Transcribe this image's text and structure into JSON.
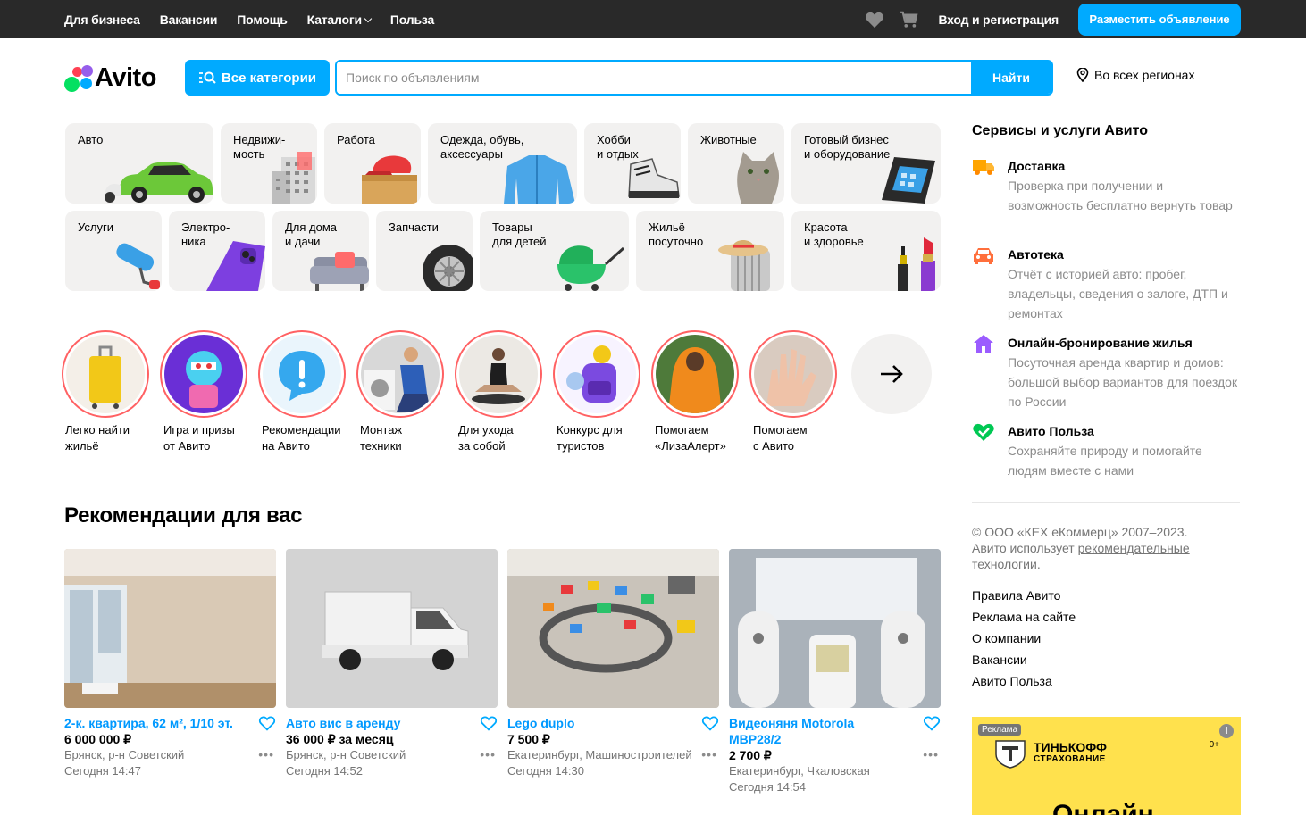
{
  "topbar": {
    "links": [
      "Для бизнеса",
      "Вакансии",
      "Помощь",
      "Каталоги",
      "Польза"
    ],
    "login": "Вход и регистрация",
    "post_button": "Разместить объявление"
  },
  "header": {
    "logo": "Avito",
    "categories_button": "Все категории",
    "search_placeholder": "Поиск по объявлениям",
    "search_button": "Найти",
    "region": "Во всех регионах"
  },
  "categories": [
    {
      "label": "Авто"
    },
    {
      "label": "Недвижи-\nмость"
    },
    {
      "label": "Работа"
    },
    {
      "label": "Одежда, обувь,\nаксессуары"
    },
    {
      "label": "Хобби\nи отдых"
    },
    {
      "label": "Животные"
    },
    {
      "label": "Готовый бизнес\nи оборудование"
    },
    {
      "label": "Услуги"
    },
    {
      "label": "Электро-\nника"
    },
    {
      "label": "Для дома\nи дачи"
    },
    {
      "label": "Запчасти"
    },
    {
      "label": "Товары\nдля детей"
    },
    {
      "label": "Жильё\nпосуточно"
    },
    {
      "label": "Красота\nи здоровье"
    }
  ],
  "stories": [
    {
      "caption": "Легко найти\nжильё"
    },
    {
      "caption": "Игра и призы\nот Авито"
    },
    {
      "caption": "Рекомендации\nна Авито"
    },
    {
      "caption": "Монтаж\nтехники"
    },
    {
      "caption": "Для ухода\nза собой"
    },
    {
      "caption": "Конкурс для\nтуристов"
    },
    {
      "caption": "Помогаем\n«ЛизаАлерт»"
    },
    {
      "caption": "Помогаем\nс Авито"
    }
  ],
  "recommendations": {
    "title": "Рекомендации для вас",
    "items": [
      {
        "title": "2-к. квартира, 62 м², 1/10 эт.",
        "price": "6 000 000 ₽",
        "location": "Брянск, р-н Советский",
        "date": "Сегодня 14:47"
      },
      {
        "title": "Авто вис в аренду",
        "price": "36 000 ₽ за месяц",
        "location": "Брянск, р-н Советский",
        "date": "Сегодня 14:52"
      },
      {
        "title": "Lego duplo",
        "price": "7 500 ₽",
        "location": "Екатеринбург, Машиностроителей",
        "date": "Сегодня 14:30"
      },
      {
        "title": "Видеоняня Motorola MBP28/2",
        "price": "2 700 ₽",
        "location": "Екатеринбург, Чкаловская",
        "date": "Сегодня 14:54"
      }
    ]
  },
  "services": {
    "title": "Сервисы и услуги Авито",
    "items": [
      {
        "name": "Доставка",
        "desc": "Проверка при получении и возможность бесплатно вернуть товар",
        "icon_color": "#ffa500"
      },
      {
        "name": "Автотека",
        "desc": "Отчёт с историей авто: пробег, владельцы, сведения о залоге, ДТП и ремонтах",
        "icon_color": "#ff6f3c"
      },
      {
        "name": "Онлайн-бронирование жилья",
        "desc": "Посуточная аренда квартир и домов: большой выбор вариантов для поездок по России",
        "icon_color": "#9b5cff"
      },
      {
        "name": "Авито Польза",
        "desc": "Сохраняйте природу и помогайте людям вместе с нами",
        "icon_color": "#00c853"
      }
    ]
  },
  "footer": {
    "copyright": "© ООО «КЕХ еКоммерц» 2007–2023.",
    "uses_text": "Авито использует",
    "rec_link": "рекомендательные технологии",
    "period": ".",
    "links": [
      "Правила Авито",
      "Реклама на сайте",
      "О компании",
      "Вакансии",
      "Авито Польза"
    ]
  },
  "ad": {
    "tag": "Реклама",
    "brand": "ТИНЬКОФФ",
    "brand_sub": "СТРАХОВАНИЕ",
    "age": "0+",
    "headline": "Онлайн",
    "info": "i"
  }
}
